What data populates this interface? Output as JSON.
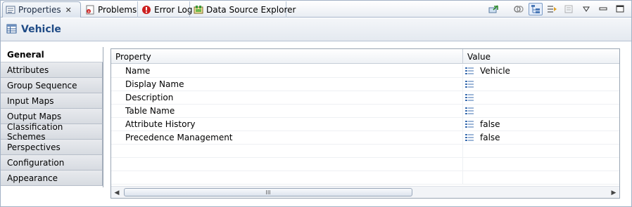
{
  "tabs": [
    {
      "label": "Properties",
      "icon": "properties-icon",
      "active": true,
      "closable": true
    },
    {
      "label": "Problems",
      "icon": "problems-icon",
      "active": false
    },
    {
      "label": "Error Log",
      "icon": "error-log-icon",
      "active": false
    },
    {
      "label": "Data Source Explorer",
      "icon": "data-source-explorer-icon",
      "active": false
    }
  ],
  "toolbar": {
    "icons": [
      "pin-icon",
      "link-icon",
      "tree-icon",
      "filter-icon",
      "view-menu-icon",
      "minimize-icon",
      "maximize-icon"
    ]
  },
  "header": {
    "title": "Vehicle",
    "icon": "table-icon"
  },
  "nav": {
    "items": [
      {
        "label": "General",
        "active": true
      },
      {
        "label": "Attributes"
      },
      {
        "label": "Group Sequence"
      },
      {
        "label": "Input Maps"
      },
      {
        "label": "Output Maps"
      },
      {
        "label": "Classification Schemes"
      },
      {
        "label": "Perspectives"
      },
      {
        "label": "Configuration"
      },
      {
        "label": "Appearance"
      }
    ]
  },
  "table": {
    "columns": [
      "Property",
      "Value"
    ],
    "rows": [
      {
        "property": "Name",
        "value": "Vehicle"
      },
      {
        "property": "Display Name",
        "value": ""
      },
      {
        "property": "Description",
        "value": ""
      },
      {
        "property": "Table Name",
        "value": ""
      },
      {
        "property": "Attribute History",
        "value": "false"
      },
      {
        "property": "Precedence Management",
        "value": "false"
      }
    ],
    "empty_rows": 3,
    "scrollbar_thumb_label": "III"
  },
  "colors": {
    "accent": "#1f4b86",
    "border": "#a3b2c6"
  }
}
